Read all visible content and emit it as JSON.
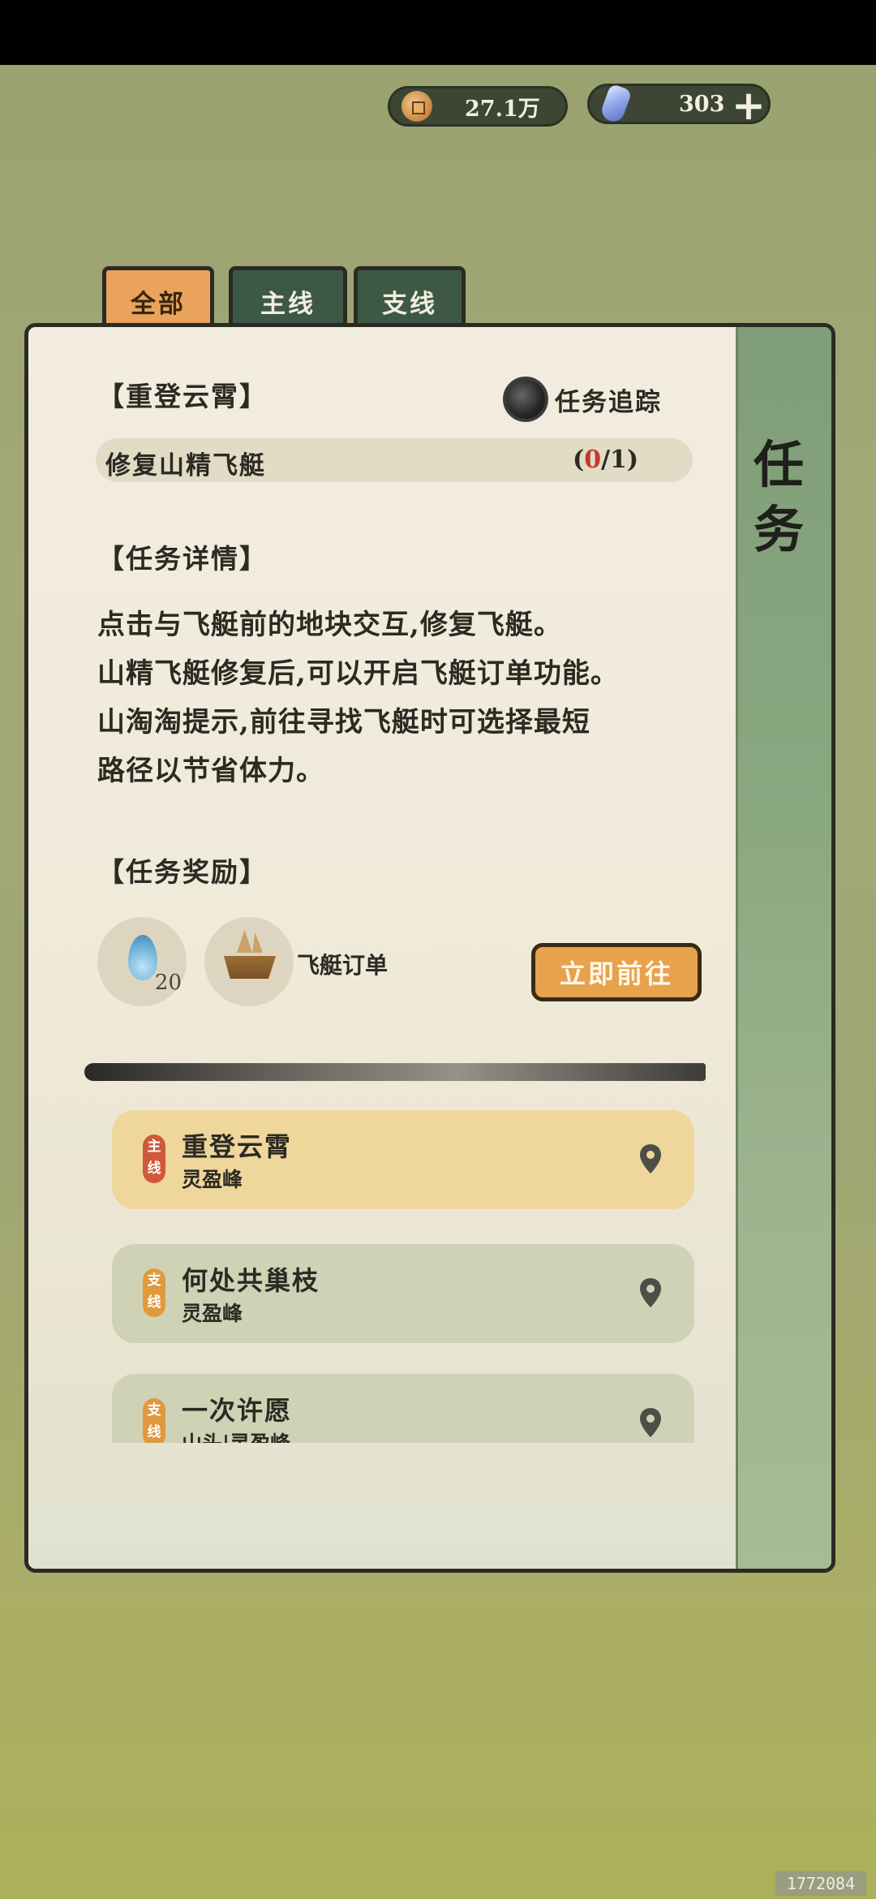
{
  "currency": {
    "coins": "27.1万",
    "gems": "303",
    "add_label": "+"
  },
  "tabs": [
    {
      "label": "全部",
      "active": true
    },
    {
      "label": "主线",
      "active": false
    },
    {
      "label": "支线",
      "active": false
    }
  ],
  "panel": {
    "side_title_1": "任",
    "side_title_2": "务"
  },
  "quest": {
    "title": "【重登云霄】",
    "track_label": "任务追踪",
    "objective": "修复山精飞艇",
    "progress_open": "(",
    "progress_current": "0",
    "progress_total": "/1)"
  },
  "details": {
    "heading": "【任务详情】",
    "lines": [
      "点击与飞艇前的地块交互,修复飞艇。",
      "山精飞艇修复后,可以开启飞艇订单功能。",
      "山淘淘提示,前往寻找飞艇时可选择最短",
      "路径以节省体力。"
    ]
  },
  "rewards": {
    "heading": "【任务奖励】",
    "items": [
      {
        "icon": "water-drop-icon",
        "count": "20"
      },
      {
        "icon": "airship-icon",
        "label": "飞艇订单"
      }
    ],
    "go_button": "立即前往"
  },
  "quest_list": [
    {
      "tag": "主\n线",
      "title": "重登云霄",
      "location": "灵盈峰",
      "type": "main"
    },
    {
      "tag": "支\n线",
      "title": "何处共巢枝",
      "location": "灵盈峰",
      "type": "branch"
    },
    {
      "tag": "支\n线",
      "title": "一次许愿",
      "location": "山头|灵盈峰",
      "type": "branch"
    }
  ],
  "watermark": "1772084",
  "colors": {
    "accent_orange": "#e7a24d",
    "tab_green": "#3d5946",
    "main_item": "#efd69b",
    "branch_item": "#cfd2b4",
    "progress_red": "#c23a2c"
  }
}
